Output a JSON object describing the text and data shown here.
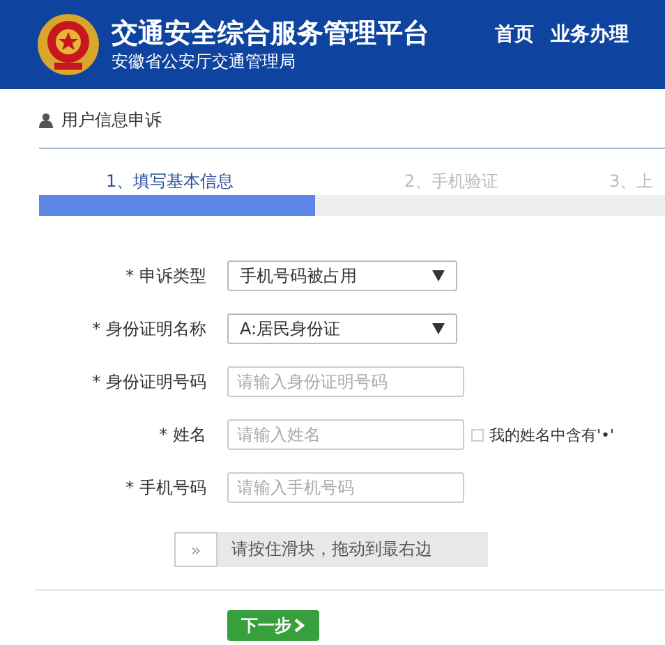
{
  "header": {
    "title": "交通安全综合服务管理平台",
    "subtitle": "安徽省公安厅交通管理局",
    "nav": [
      {
        "label": "首页",
        "selected": false
      },
      {
        "label": "业务办理",
        "selected": false
      }
    ]
  },
  "breadcrumb": "用户信息申诉",
  "steps": [
    {
      "label": "1、填写基本信息",
      "selected": true
    },
    {
      "label": "2、手机验证",
      "selected": false
    },
    {
      "label": "3、上",
      "selected": false
    }
  ],
  "progress": {
    "level": 0.44
  },
  "form": [
    {
      "kind": "select",
      "label": "* 申诉类型",
      "value": "手机号码被占用"
    },
    {
      "kind": "select",
      "label": "* 身份证明名称",
      "value": "A:居民身份证"
    },
    {
      "kind": "input",
      "label": "* 身份证明号码",
      "placeholder": "请输入身份证明号码"
    },
    {
      "kind": "input",
      "label": "* 姓名",
      "placeholder": "请输入姓名",
      "checkbox": {
        "label": "我的姓名中含有'•'",
        "checked": false
      }
    },
    {
      "kind": "input",
      "label": "* 手机号码",
      "placeholder": "请输入手机号码"
    }
  ],
  "slider": {
    "handle": "»",
    "text": "请按住滑块，拖动到最右边"
  },
  "next_button": "下一步"
}
